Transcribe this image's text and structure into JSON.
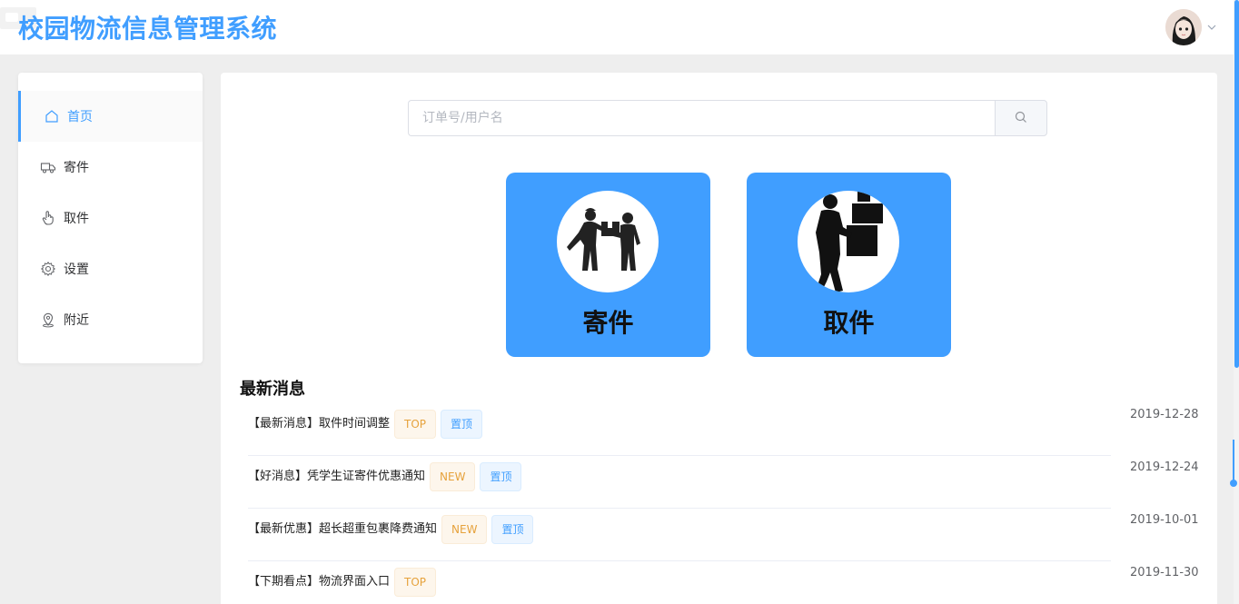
{
  "header": {
    "title": "校园物流信息管理系统"
  },
  "sidebar": {
    "items": [
      {
        "label": "首页",
        "icon": "home-icon",
        "active": true
      },
      {
        "label": "寄件",
        "icon": "truck-icon",
        "active": false
      },
      {
        "label": "取件",
        "icon": "hand-pointer-icon",
        "active": false
      },
      {
        "label": "设置",
        "icon": "gear-icon",
        "active": false
      },
      {
        "label": "附近",
        "icon": "location-icon",
        "active": false
      }
    ]
  },
  "search": {
    "placeholder": "订单号/用户名"
  },
  "cards": {
    "send_label": "寄件",
    "pickup_label": "取件"
  },
  "news": {
    "title": "最新消息",
    "items": [
      {
        "text": "【最新消息】取件时间调整",
        "tags": [
          "TOP",
          "置顶"
        ],
        "date": "2019-12-28"
      },
      {
        "text": "【好消息】凭学生证寄件优惠通知",
        "tags": [
          "NEW",
          "置顶"
        ],
        "date": "2019-12-24"
      },
      {
        "text": "【最新优惠】超长超重包裹降费通知",
        "tags": [
          "NEW",
          "置顶"
        ],
        "date": "2019-10-01"
      },
      {
        "text": "【下期看点】物流界面入口",
        "tags": [
          "TOP"
        ],
        "date": "2019-11-30"
      }
    ]
  },
  "colors": {
    "accent": "#409eff",
    "tag_warning": "#e6a23c",
    "tag_info": "#409eff"
  }
}
